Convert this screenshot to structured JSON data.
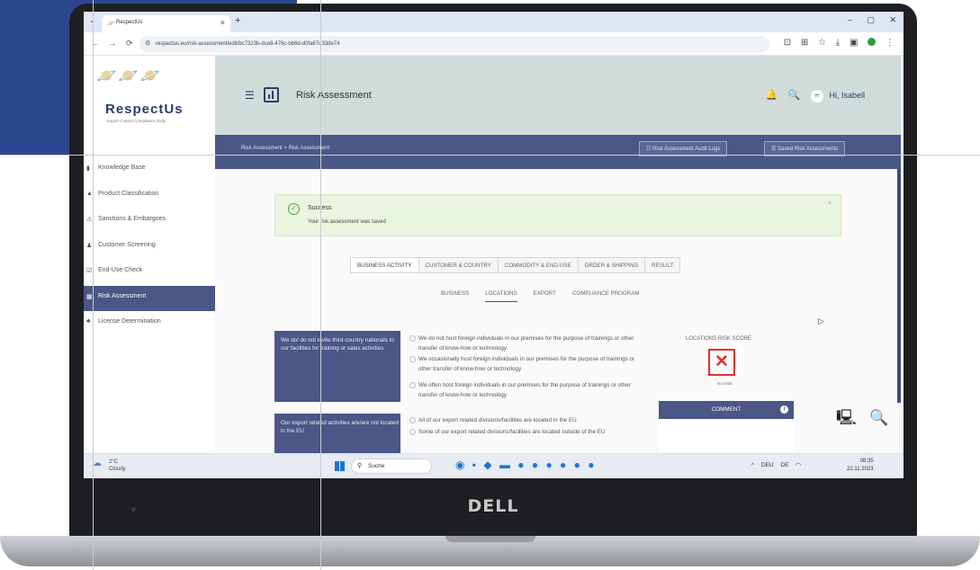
{
  "browser": {
    "tab_title": "RespectUs",
    "url": "respectus.eu/risk-assessment/edit/bc7323b-dce8-476c-bb6d-d0fa67d33de74"
  },
  "app": {
    "brand": "RespectUs",
    "tagline": "Export Control Compliance Daily",
    "page_title": "Risk Assessment",
    "user_initials": "H",
    "user_greeting": "Hi, Isabell"
  },
  "sidebar": {
    "items": [
      {
        "label": "Knowledge Base",
        "icon": "book-icon"
      },
      {
        "label": "Product Classification",
        "icon": "tag-icon"
      },
      {
        "label": "Sanctions & Embargoes",
        "icon": "warning-icon"
      },
      {
        "label": "Customer Screening",
        "icon": "users-icon"
      },
      {
        "label": "End-Use Check",
        "icon": "check-icon"
      },
      {
        "label": "Risk Assessment",
        "icon": "chart-icon",
        "active": true
      },
      {
        "label": "License Determination",
        "icon": "license-icon"
      }
    ]
  },
  "breadcrumb": "Risk Assessment > Risk Assessment",
  "buttons": {
    "audit_logs": "Risk Assessment Audit Logs",
    "saved": "Saved Risk Assessments"
  },
  "alert": {
    "title": "Success",
    "text": "Your risk assessment was saved"
  },
  "main_tabs": [
    "BUSINESS ACTIVITY",
    "CUSTOMER & COUNTRY",
    "COMMODITY & END-USE",
    "ORDER & SHIPPING",
    "RESULT"
  ],
  "sub_tabs": [
    "BUSINESS",
    "LOCATIONS",
    "EXPORT",
    "COMPLIANCE PROGRAM"
  ],
  "questions": [
    {
      "text": "We do/ do not invite third country nationals to our facilities for training or sales activities",
      "options": [
        "We do not host foreign individuals in our premises for the purpose of trainings or other transfer of know-how or technology",
        "We occasionally host foreign individuals in our premises for the purpose of trainings or other transfer of know-how or technology",
        "We often host foreign individuals in our premises for the purpose of trainings or other transfer of know-how or technology"
      ]
    },
    {
      "text": "Our export related activities are/are not located in the EU",
      "options": [
        "All of our export related divisions/facilities are located in the EU",
        "Some of our export related divisions/facilities are located outside of the EU"
      ]
    }
  ],
  "score": {
    "label": "LOCATIONS RISK SCORE",
    "status": "No Data"
  },
  "comment": {
    "label": "COMMENT"
  },
  "taskbar": {
    "temperature": "2°C",
    "weather": "Cloudy",
    "search_placeholder": "Suche",
    "lang_top": "DEU",
    "lang_bottom": "DE",
    "time": "08:35",
    "date": "22.11.2023"
  },
  "laptop_brand": "DELL"
}
